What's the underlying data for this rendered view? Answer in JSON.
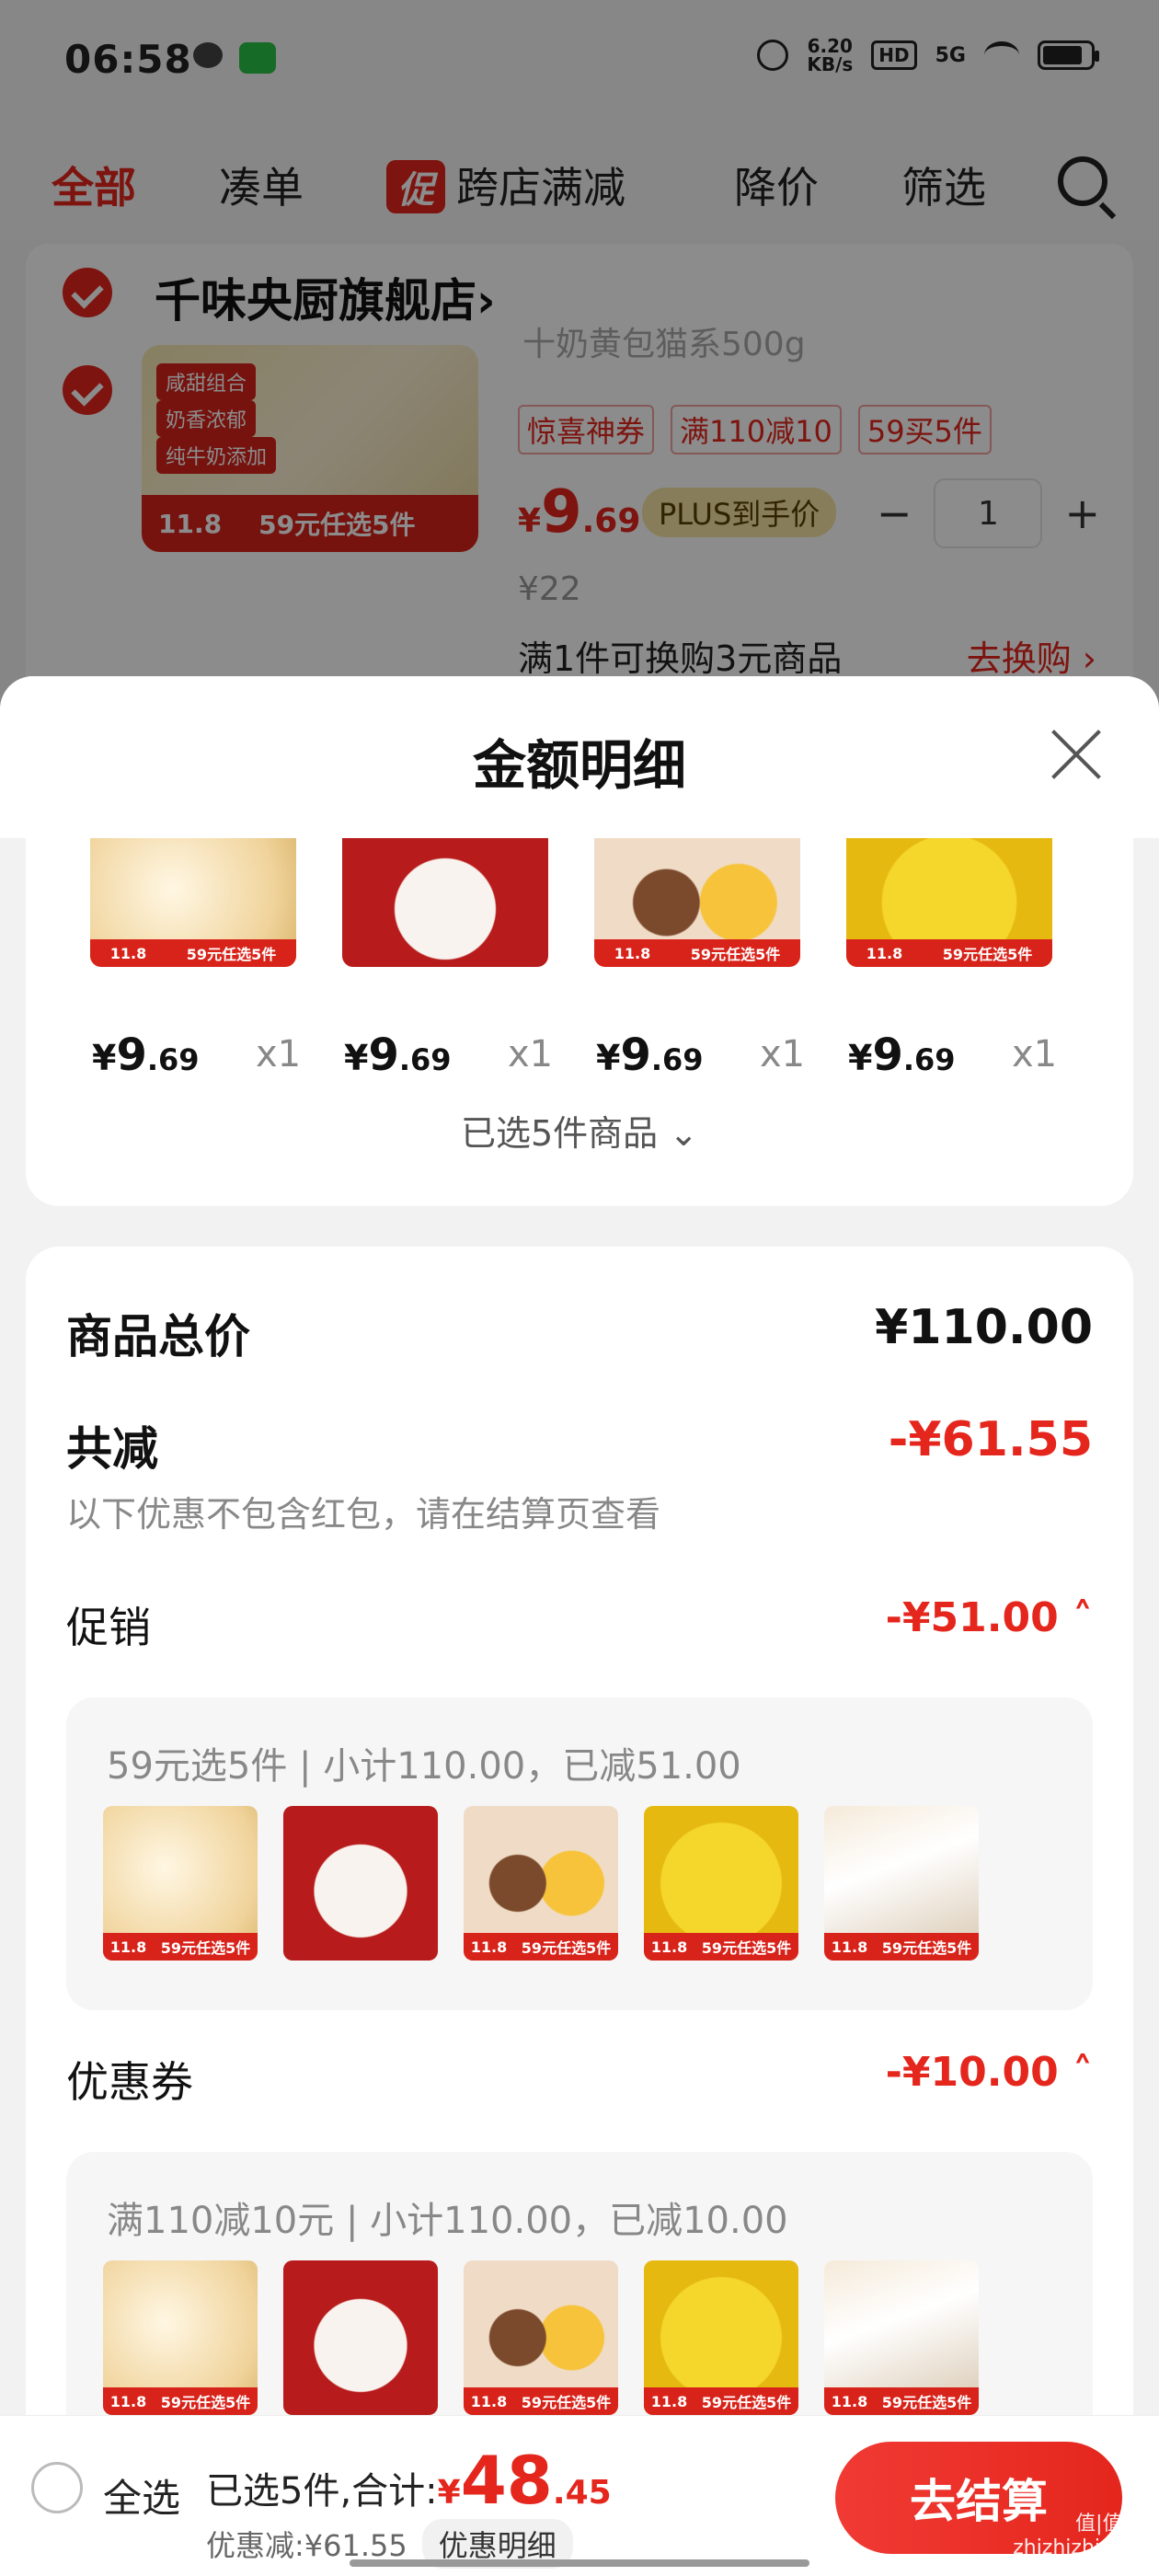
{
  "status_bar": {
    "time": "06:58",
    "net_speed": "6.20",
    "net_unit": "KB/s",
    "hd": "HD",
    "signal": "5G",
    "icons": [
      "chat-icon",
      "wechat-icon",
      "alarm-icon",
      "wifi-icon",
      "battery-icon"
    ]
  },
  "top_tabs": [
    {
      "label": "全部",
      "active": true
    },
    {
      "label": "凑单",
      "active": false
    },
    {
      "label": "跨店满减",
      "active": false,
      "chip": "促"
    },
    {
      "label": "降价",
      "active": false
    },
    {
      "label": "筛选",
      "active": false
    }
  ],
  "store": {
    "name": "千味央厨旗舰店",
    "chevron": "›",
    "product": {
      "subtitle": "十奶黄包猫系500g",
      "thumb_tags": [
        "咸甜组合",
        "奶香浓郁",
        "纯牛奶添加"
      ],
      "thumb_price": "11.8",
      "thumb_band": "59元任选5件",
      "tags": [
        "惊喜神券",
        "满110减10",
        "59买5件"
      ],
      "price_yen": "¥",
      "price_int": "9",
      "price_dec": ".69",
      "plus_label": "PLUS到手价",
      "qty": "1",
      "minus": "−",
      "plus": "+",
      "original_price": "¥22",
      "exchange_text": "满1件可换购3元商品",
      "exchange_link": "去换购 ›"
    }
  },
  "sheet": {
    "title": "金额明细",
    "items": [
      {
        "price_yen": "¥",
        "price_int": "9",
        "price_dec": ".69",
        "qty": "x1",
        "thumb_price": "11.8",
        "thumb_band": "59元任选5件"
      },
      {
        "price_yen": "¥",
        "price_int": "9",
        "price_dec": ".69",
        "qty": "x1",
        "thumb_price": "",
        "thumb_band": ""
      },
      {
        "price_yen": "¥",
        "price_int": "9",
        "price_dec": ".69",
        "qty": "x1",
        "thumb_price": "11.8",
        "thumb_band": "59元任选5件"
      },
      {
        "price_yen": "¥",
        "price_int": "9",
        "price_dec": ".69",
        "qty": "x1",
        "thumb_price": "11.8",
        "thumb_band": "59元任选5件"
      }
    ],
    "selected_toggle": "已选5件商品 ⌄",
    "summary": {
      "total_label": "商品总价",
      "total_value": "¥110.00",
      "reduce_label": "共减",
      "reduce_value": "-¥61.55",
      "reduce_note": "以下优惠不包含红包，请在结算页查看",
      "promo_label": "促销",
      "promo_value": "-¥51.00 ˄",
      "promo_caption": "59元选5件 | 小计110.00，已减51.00",
      "coupon_label": "优惠券",
      "coupon_value": "-¥10.00 ˄",
      "coupon_caption": "满110减10元 | 小计110.00，已减10.00",
      "mini_band_price": "11.8",
      "mini_band_text": "59元任选5件"
    }
  },
  "bottom_bar": {
    "select_all": "全选",
    "total_prefix": "已选5件,合计:",
    "total_yen": "¥",
    "total_int": "48",
    "total_dec": ".45",
    "discount_text": "优惠减:¥61.55",
    "detail_chip": "优惠明细",
    "checkout": "去结算"
  },
  "watermark": "值|值|值\nzhizhizhi.com",
  "colors": {
    "accent": "#e4261d",
    "sheet_bg": "#f2f2f2",
    "overlay": "rgba(0,0,0,0.45)"
  }
}
